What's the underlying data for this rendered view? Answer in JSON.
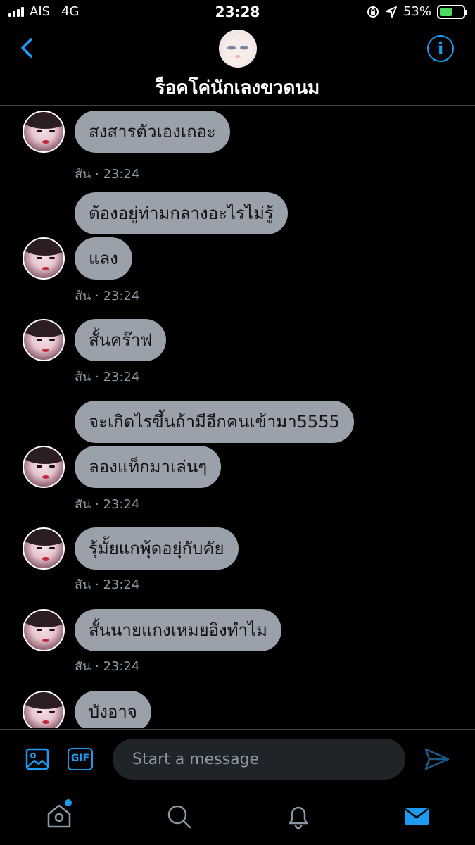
{
  "status_bar": {
    "carrier": "AIS",
    "network": "4G",
    "time": "23:28",
    "battery": "53%",
    "battery_level": 0.53
  },
  "header": {
    "title": "ร็อคโค่นักเลงขวดนม"
  },
  "messages": [
    {
      "text": "สงสารตัวเองเถอะ"
    },
    {
      "text": "ต้องอยู่ท่ามกลางอะไรไม่รู้"
    },
    {
      "text": "แลง"
    },
    {
      "text": "สั้นคร๊าฟ"
    },
    {
      "text": "จะเกิดไรขึ้นถ้ามีอีกคนเข้ามา5555"
    },
    {
      "text": "ลองแท็กมาเล่นๆ"
    },
    {
      "text": "รุ้มั้ยแกพุ้ดอยุ่กับคัย"
    },
    {
      "text": "สั้นนายแกงเหมยอิงทำไม"
    },
    {
      "text": "บังอาจ"
    }
  ],
  "timestamps": [
    "สัน · 23:24",
    "สัน · 23:24",
    "สัน · 23:24",
    "สัน · 23:24",
    "สัน · 23:24",
    "สัน · 23:24"
  ],
  "composer": {
    "placeholder": "Start a message",
    "gif_label": "GIF"
  },
  "colors": {
    "accent": "#1d9bf0",
    "bubble": "#9aa1ab",
    "background": "#000000"
  },
  "tabs": [
    {
      "icon": "home-icon",
      "has_notification_dot": true
    },
    {
      "icon": "search-icon"
    },
    {
      "icon": "bell-icon"
    },
    {
      "icon": "mail-icon",
      "active": true
    }
  ]
}
